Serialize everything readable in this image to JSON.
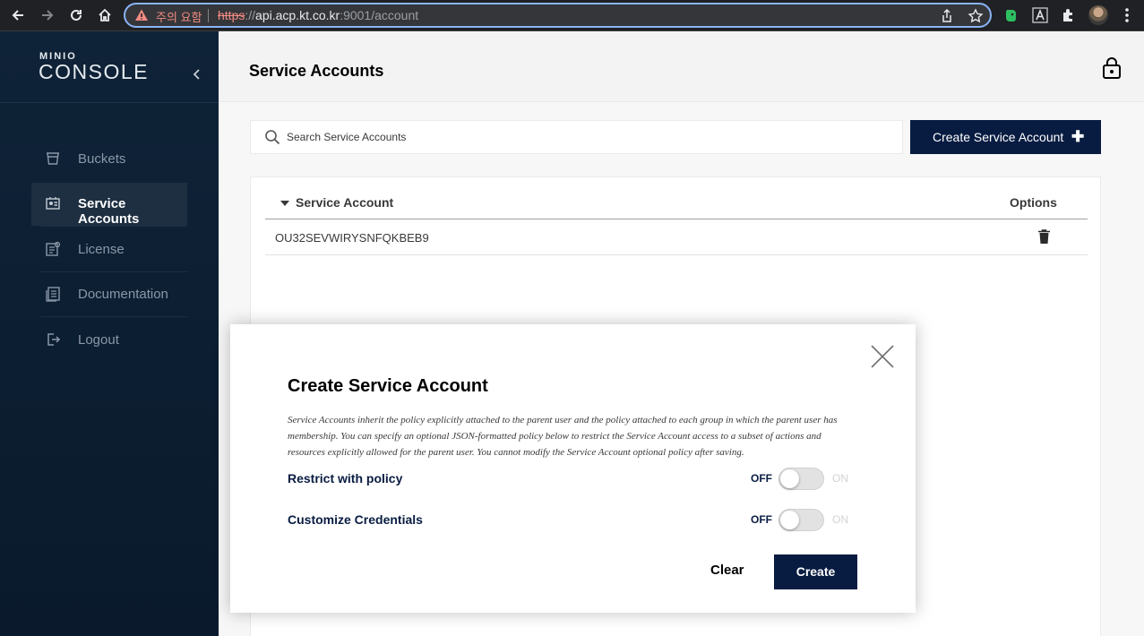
{
  "browser": {
    "warning_text": "주의 요함",
    "url_scheme": "https",
    "url_host": "api.acp.kt.co.kr",
    "url_rest": ":9001/account"
  },
  "sidebar": {
    "logo_top": "MINIO",
    "logo_bottom": "CONSOLE",
    "items": [
      {
        "label": "Buckets",
        "icon": "bucket-icon"
      },
      {
        "label": "Service Accounts",
        "icon": "service-accounts-icon",
        "active": true
      },
      {
        "label": "License",
        "icon": "license-icon"
      },
      {
        "label": "Documentation",
        "icon": "documentation-icon"
      },
      {
        "label": "Logout",
        "icon": "logout-icon"
      }
    ]
  },
  "header": {
    "title": "Service Accounts"
  },
  "toolbar": {
    "search_placeholder": "Search Service Accounts",
    "create_label": "Create Service Account"
  },
  "table": {
    "columns": [
      "Service Account",
      "Options"
    ],
    "rows": [
      {
        "account": "OU32SEVWIRYSNFQKBEB9"
      }
    ]
  },
  "modal": {
    "title": "Create Service Account",
    "description": "Service Accounts inherit the policy explicitly attached to the parent user and the policy attached to each group in which the parent user has membership. You can specify an optional JSON-formatted policy below to restrict the Service Account access to a subset of actions and resources explicitly allowed for the parent user. You cannot modify the Service Account optional policy after saving.",
    "options": [
      {
        "label": "Restrict with policy",
        "off": "OFF",
        "on": "ON",
        "enabled": false
      },
      {
        "label": "Customize Credentials",
        "off": "OFF",
        "on": "ON",
        "enabled": false
      }
    ],
    "clear_label": "Clear",
    "create_label": "Create"
  },
  "colors": {
    "sidebar_bg": "#0f2338",
    "primary": "#081c42",
    "warning": "#f28b82"
  }
}
